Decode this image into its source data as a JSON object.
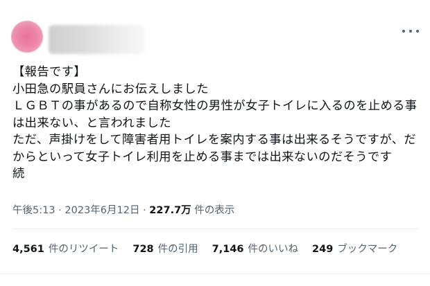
{
  "tweet": {
    "more_icon": "more-horizontal-icon",
    "lines": [
      "【報告です】",
      "小田急の駅員さんにお伝えしました",
      "ＬＧＢＴの事があるので自称女性の男性が女子トイレに入るのを止める事",
      "は出来ない、と言われました",
      "ただ、声掛けをして障害者用トイレを案内する事は出来るそうですが、だ",
      "からといって女子トイレ利用を止める事までは出来ないのだそうです",
      "続"
    ],
    "time": "午後5:13",
    "sep1": " · ",
    "date": "2023年6月12日",
    "sep2": " · ",
    "views_count": "227.7万",
    "views_label": "件の表示"
  },
  "stats": [
    {
      "count": "4,561",
      "label": "件のリツイート"
    },
    {
      "count": "728",
      "label": "件の引用"
    },
    {
      "count": "7,146",
      "label": "件のいいね"
    },
    {
      "count": "249",
      "label": "ブックマーク"
    }
  ]
}
